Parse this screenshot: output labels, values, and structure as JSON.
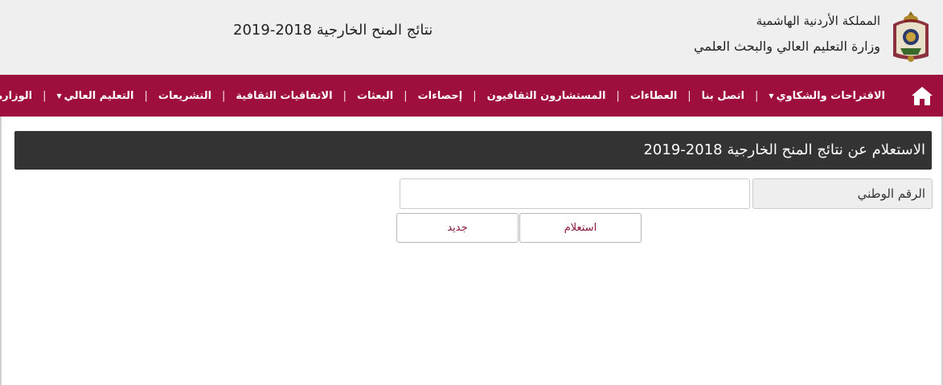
{
  "header": {
    "kingdom": "المملكة الأردنية الهاشمية",
    "ministry": "وزارة التعليم العالي والبحث العلمي",
    "title": "نتائج المنح الخارجية 2018-2019",
    "emblem_icon": "jordan-coat-of-arms-icon"
  },
  "nav": {
    "home_icon": "home-icon",
    "items": [
      {
        "label": "الوزارة",
        "has_dropdown": true
      },
      {
        "label": "التعليم العالي",
        "has_dropdown": true
      },
      {
        "label": "التشريعات",
        "has_dropdown": false
      },
      {
        "label": "الاتفاقيات الثقافية",
        "has_dropdown": false
      },
      {
        "label": "البعثات",
        "has_dropdown": false
      },
      {
        "label": "إحصاءات",
        "has_dropdown": false
      },
      {
        "label": "المستشارون الثقافيون",
        "has_dropdown": false
      },
      {
        "label": "العطاءات",
        "has_dropdown": false
      },
      {
        "label": "اتصل بنا",
        "has_dropdown": false
      },
      {
        "label": "الاقتراحات والشكاوي",
        "has_dropdown": true
      }
    ],
    "background_color": "#9e0f3d"
  },
  "panel": {
    "title": "الاستعلام عن نتائج المنح الخارجية 2018-2019"
  },
  "form": {
    "national_id_label": "الرقم الوطني",
    "national_id_value": "",
    "query_button": "استعلام",
    "new_button": "جديد"
  }
}
